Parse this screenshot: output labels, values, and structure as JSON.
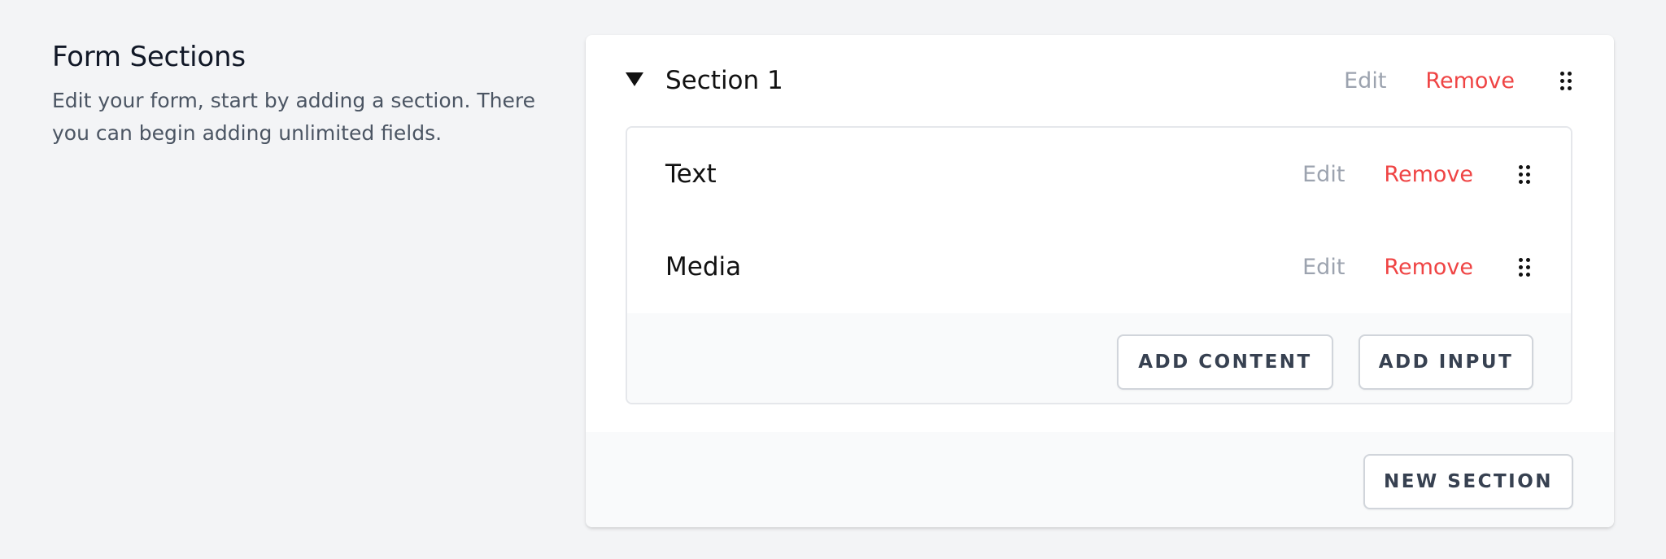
{
  "intro": {
    "title": "Form Sections",
    "description": "Edit your form, start by adding a section. There you can begin adding unlimited fields."
  },
  "section": {
    "title": "Section 1",
    "edit_label": "Edit",
    "remove_label": "Remove",
    "toggle_icon": "caret-down-icon",
    "drag_icon": "drag-handle-icon"
  },
  "fields": [
    {
      "label": "Text",
      "edit_label": "Edit",
      "remove_label": "Remove"
    },
    {
      "label": "Media",
      "edit_label": "Edit",
      "remove_label": "Remove"
    }
  ],
  "buttons": {
    "add_content": "ADD CONTENT",
    "add_input": "ADD INPUT",
    "new_section": "NEW SECTION"
  },
  "colors": {
    "background": "#f3f4f6",
    "remove": "#ef4444",
    "edit": "#9ca3af",
    "panel_footer": "#f9fafb"
  }
}
